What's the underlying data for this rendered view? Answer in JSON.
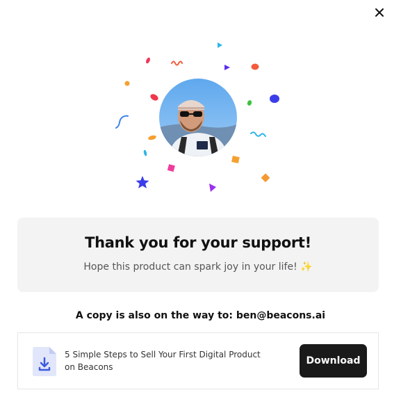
{
  "modal": {
    "close_icon": "close-icon",
    "avatar_icon": "user-avatar"
  },
  "thanks": {
    "title": "Thank you for your support!",
    "subtitle": "Hope this product can spark joy in your life! ✨"
  },
  "copy_notice": "A copy is also on the way to: ben@beacons.ai",
  "product": {
    "title": "5 Simple Steps to Sell Your First Digital Product on Beacons",
    "icon": "download-file-icon",
    "download_label": "Download"
  },
  "colors": {
    "primary_button": "#1a1a1a",
    "card_background": "#f3f3f3",
    "file_icon_bg": "#e2e6fb",
    "file_icon_accent": "#3b5bdb"
  }
}
